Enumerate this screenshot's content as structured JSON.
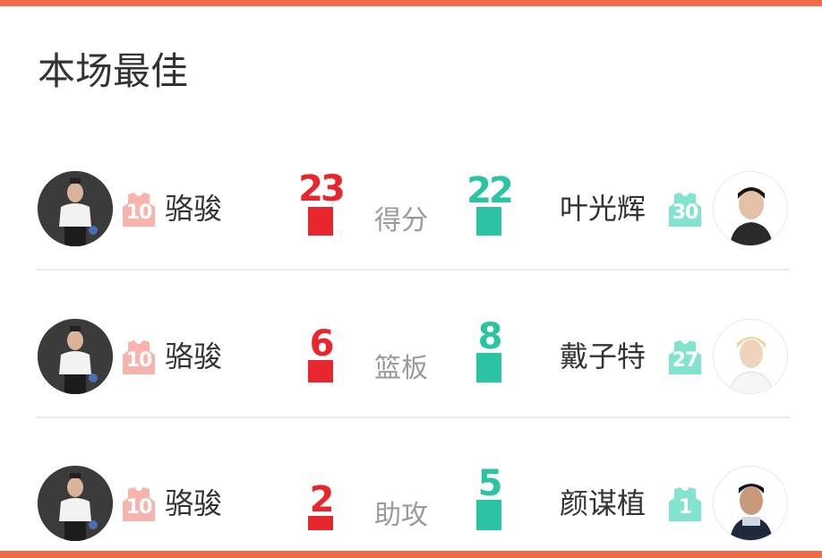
{
  "title": "本场最佳",
  "colors": {
    "accent": "#f26a45",
    "home": "#e8262d",
    "away": "#2bc4a3",
    "home_jersey": "#f7b3ac",
    "away_jersey": "#82e3cf"
  },
  "rows": [
    {
      "stat": "得分",
      "home": {
        "name": "骆骏",
        "number": "10",
        "value": "23"
      },
      "away": {
        "name": "叶光辉",
        "number": "30",
        "value": "22"
      }
    },
    {
      "stat": "篮板",
      "home": {
        "name": "骆骏",
        "number": "10",
        "value": "6"
      },
      "away": {
        "name": "戴子特",
        "number": "27",
        "value": "8"
      }
    },
    {
      "stat": "助攻",
      "home": {
        "name": "骆骏",
        "number": "10",
        "value": "2"
      },
      "away": {
        "name": "颜谋植",
        "number": "1",
        "value": "5"
      }
    }
  ]
}
